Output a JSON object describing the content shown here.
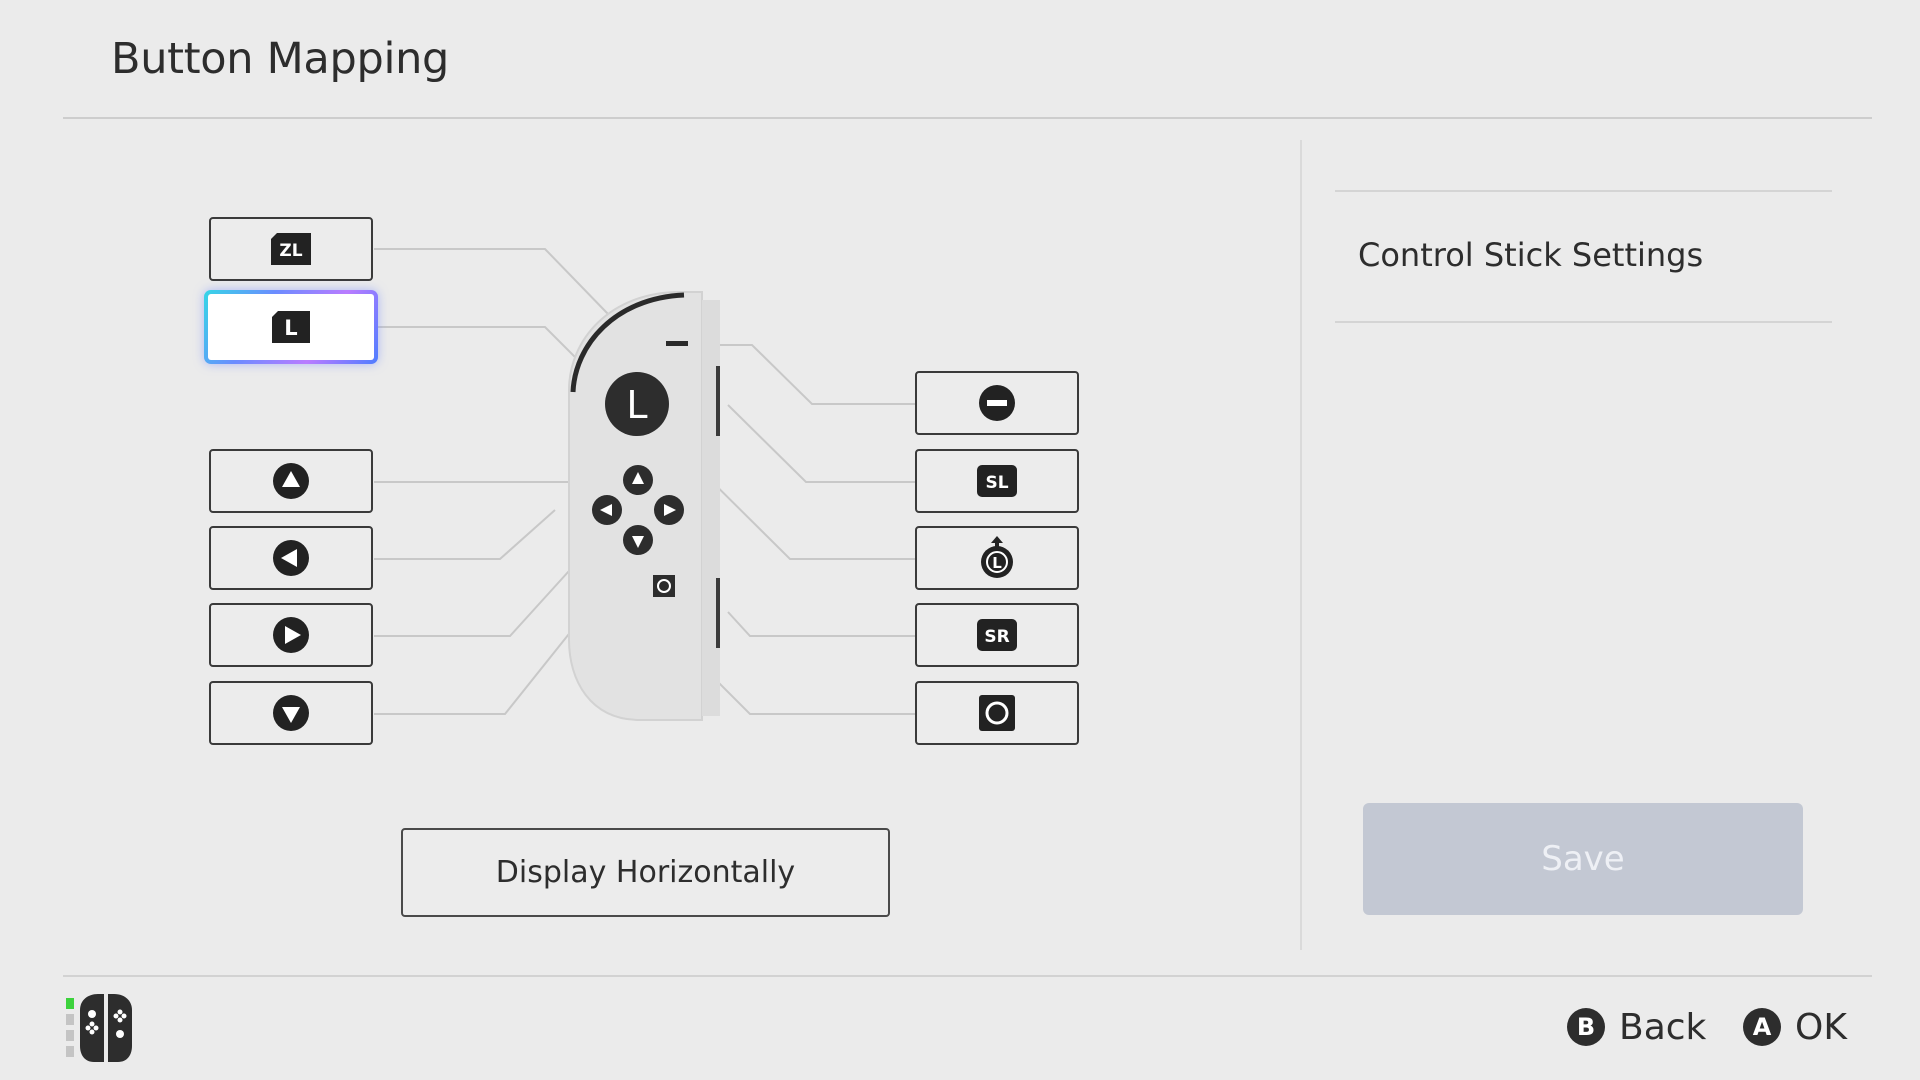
{
  "header": {
    "title": "Button Mapping"
  },
  "left_buttons": [
    {
      "id": "zl",
      "glyph": "ZL",
      "icon": "zl-button-icon",
      "selected": false
    },
    {
      "id": "l",
      "glyph": "L",
      "icon": "l-button-icon",
      "selected": true
    },
    {
      "id": "up",
      "glyph": "",
      "icon": "dpad-up-icon",
      "selected": false
    },
    {
      "id": "left",
      "glyph": "",
      "icon": "dpad-left-icon",
      "selected": false
    },
    {
      "id": "right",
      "glyph": "",
      "icon": "dpad-right-icon",
      "selected": false
    },
    {
      "id": "down",
      "glyph": "",
      "icon": "dpad-down-icon",
      "selected": false
    }
  ],
  "right_buttons": [
    {
      "id": "minus",
      "glyph": "",
      "icon": "minus-button-icon"
    },
    {
      "id": "sl",
      "glyph": "SL",
      "icon": "sl-button-icon"
    },
    {
      "id": "lstick",
      "glyph": "L",
      "icon": "left-stick-press-icon"
    },
    {
      "id": "sr",
      "glyph": "SR",
      "icon": "sr-button-icon"
    },
    {
      "id": "capture",
      "glyph": "",
      "icon": "capture-button-icon"
    }
  ],
  "joycon": {
    "stick_label": "L"
  },
  "display_button": {
    "label": "Display Horizontally"
  },
  "right_panel": {
    "control_stick_settings": "Control Stick Settings",
    "save_label": "Save"
  },
  "footer": {
    "back": {
      "glyph": "B",
      "label": "Back"
    },
    "ok": {
      "glyph": "A",
      "label": "OK"
    }
  },
  "colors": {
    "background": "#ebebeb",
    "text": "#2d2d2d",
    "save_disabled": "#c3c8d3",
    "selection_glow": "#6b8cff",
    "player_indicator": "#3cd23c"
  }
}
